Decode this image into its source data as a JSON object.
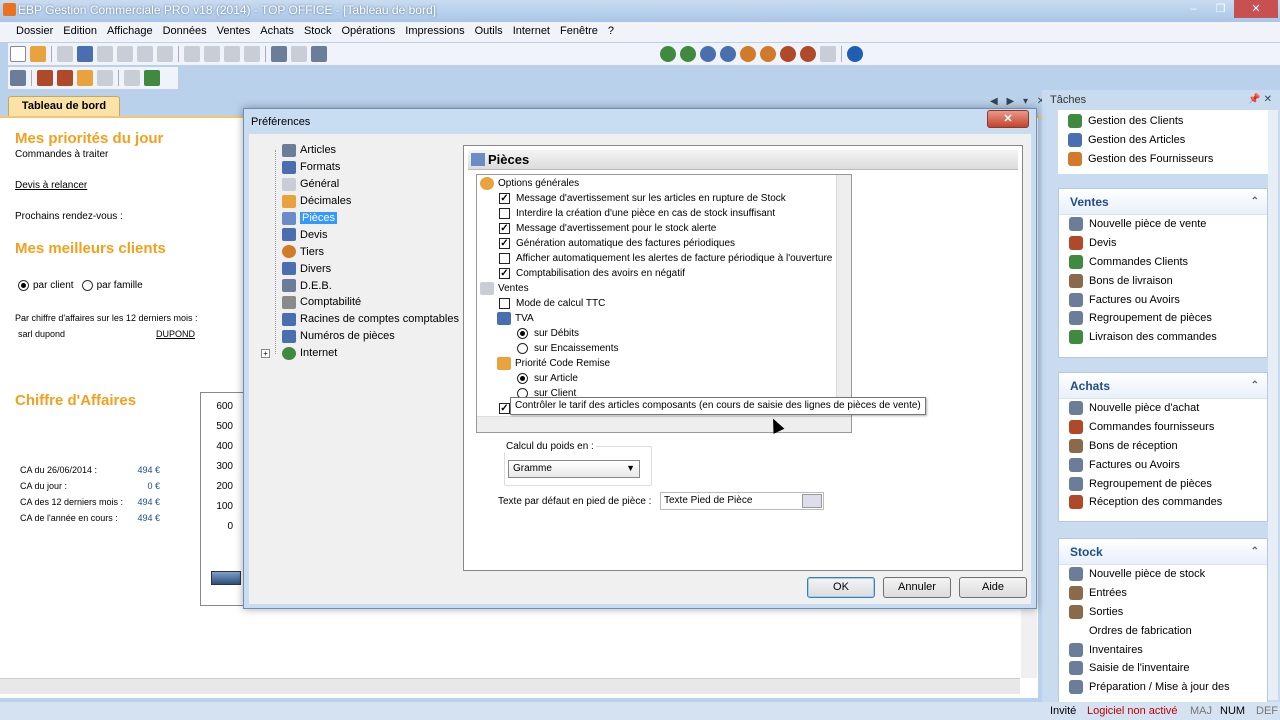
{
  "window": {
    "title": "EBP Gestion Commerciale PRO v18 (2014) - TOP OFFICE - [Tableau de bord]",
    "controls": [
      "–",
      "❐",
      "✕"
    ]
  },
  "menu": [
    "Dossier",
    "Edition",
    "Affichage",
    "Données",
    "Ventes",
    "Achats",
    "Stock",
    "Opérations",
    "Impressions",
    "Outils",
    "Internet",
    "Fenêtre",
    "?"
  ],
  "tab": {
    "label": "Tableau de bord",
    "nav": "◀ ▶ ▾ ✕"
  },
  "dashboard": {
    "priorities_title": "Mes priorités du jour",
    "commandes": "Commandes à traiter",
    "devis": "Devis à relancer",
    "rdv": "Prochains rendez-vous :",
    "clients_title": "Mes meilleurs clients",
    "par_client": "par client",
    "par_famille": "par famille",
    "ca_note": "Par chiffre d'affaires sur les 12 derniers mois :",
    "client_name": "sarl dupond",
    "client_link": "DUPOND",
    "ca_title": "Chiffre d'Affaires",
    "ca_rows": [
      {
        "label": "CA du 26/06/2014 :",
        "value": "494 €"
      },
      {
        "label": "CA du jour :",
        "value": "0 €"
      },
      {
        "label": "CA des 12 derniers mois :",
        "value": "494 €"
      },
      {
        "label": "CA de l'année en cours :",
        "value": "494 €"
      }
    ],
    "y_ticks": [
      "600",
      "500",
      "400",
      "300",
      "200",
      "100",
      "0"
    ]
  },
  "tasks": {
    "header": "Tâches",
    "top_items": [
      "Gestion des Clients",
      "Gestion des Articles",
      "Gestion des Fournisseurs"
    ],
    "ventes": {
      "title": "Ventes",
      "items": [
        "Nouvelle pièce de vente",
        "Devis",
        "Commandes Clients",
        "Bons de livraison",
        "Factures ou Avoirs",
        "Regroupement de pièces",
        "Livraison des commandes"
      ]
    },
    "achats": {
      "title": "Achats",
      "items": [
        "Nouvelle pièce d'achat",
        "Commandes fournisseurs",
        "Bons de réception",
        "Factures ou Avoirs",
        "Regroupement de pièces",
        "Réception des commandes"
      ]
    },
    "stock": {
      "title": "Stock",
      "items": [
        "Nouvelle pièce de stock",
        "Entrées",
        "Sorties",
        "Ordres de fabrication",
        "Inventaires",
        "Saisie de l'inventaire",
        "Préparation / Mise à jour des"
      ]
    }
  },
  "status": {
    "user": "Invité",
    "license": "Logiciel non activé",
    "maj": "MAJ",
    "num": "NUM",
    "def": "DEF"
  },
  "dialog": {
    "title": "Préférences",
    "close": "✕",
    "tree": [
      "Articles",
      "Formats",
      "Général",
      "Décimales",
      "Pièces",
      "Devis",
      "Tiers",
      "Divers",
      "D.E.B.",
      "Comptabilité",
      "Racines de comptes comptables",
      "Numéros de pièces",
      "Internet"
    ],
    "selected": "Pièces",
    "section_title": "Pièces",
    "options": {
      "general_header": "Options générales",
      "general": [
        {
          "label": "Message d'avertissement sur les articles en rupture de Stock",
          "checked": true
        },
        {
          "label": "Interdire la création d'une pièce en cas de stock insuffisant",
          "checked": false
        },
        {
          "label": "Message d'avertissement pour le stock alerte",
          "checked": true
        },
        {
          "label": "Génération automatique des factures périodiques",
          "checked": true
        },
        {
          "label": "Afficher automatiquement les alertes de facture périodique à l'ouverture",
          "checked": false
        },
        {
          "label": "Comptabilisation des avoirs en négatif",
          "checked": true
        }
      ],
      "ventes_header": "Ventes",
      "ttc": "Mode de calcul TTC",
      "tva_header": "TVA",
      "tva_debits": "sur Débits",
      "tva_encaissements": "sur Encaissements",
      "remise_header": "Priorité Code Remise",
      "remise_article": "sur Article",
      "remise_client": "sur Client",
      "tooltip": "Contrôler le tarif des articles composants (en cours de saisie des lignes de pièces de vente)"
    },
    "poids_label": "Calcul du poids en :",
    "poids_value": "Gramme",
    "footer_label": "Texte par défaut en pied de pièce :",
    "footer_value": "Texte Pied de Pièce",
    "ok": "OK",
    "annuler": "Annuler",
    "aide": "Aide"
  }
}
